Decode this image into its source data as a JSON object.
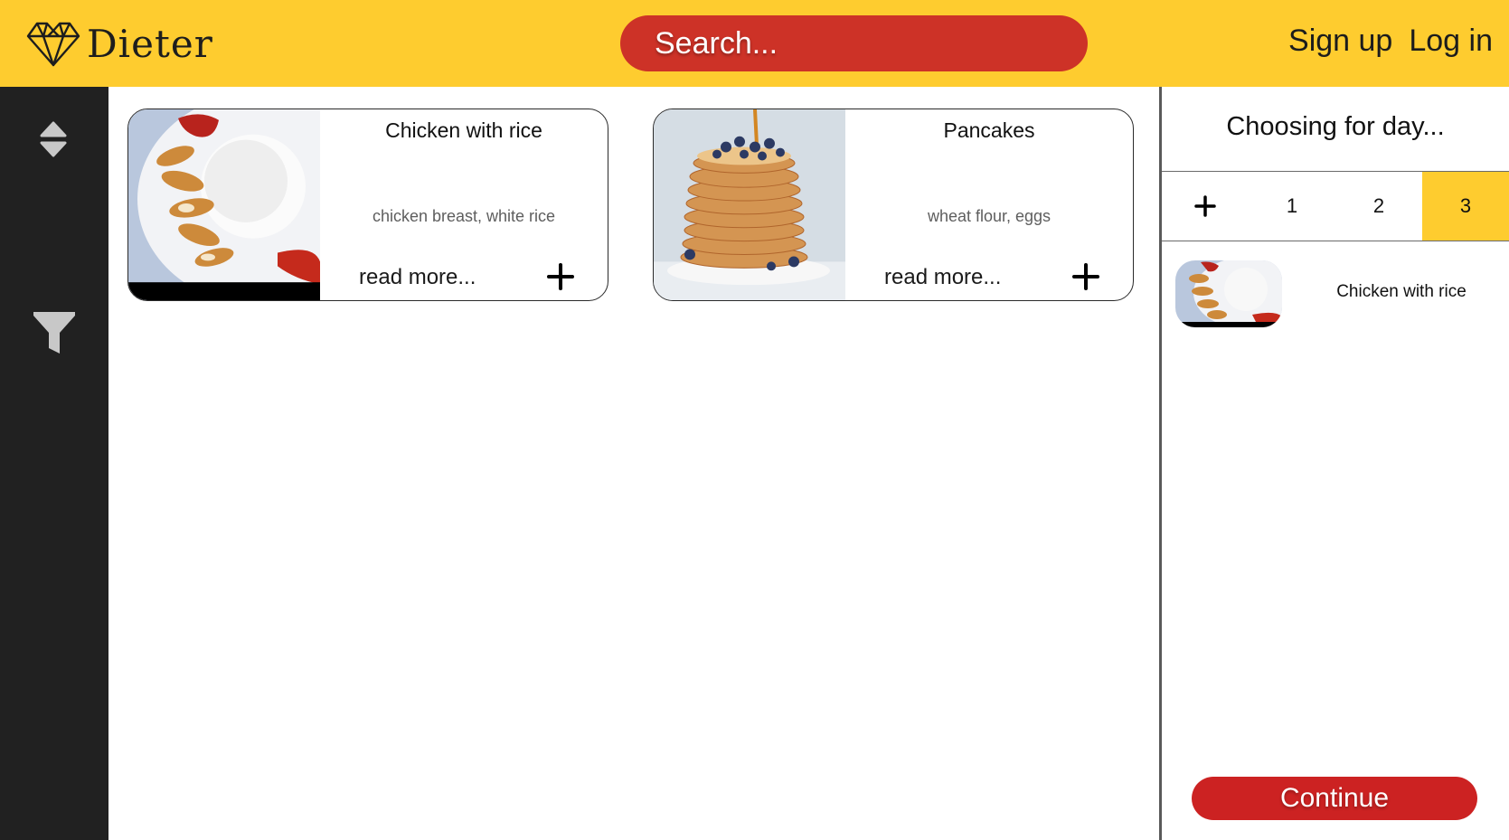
{
  "header": {
    "logo_text": "Dieter",
    "search_placeholder": "Search...",
    "signup_label": "Sign up",
    "login_label": "Log in"
  },
  "sidebar": {
    "icons": [
      "sort-icon",
      "filter-icon"
    ]
  },
  "recipes": [
    {
      "title": "Chicken with rice",
      "ingredients": "chicken breast, white rice",
      "read_more": "read more...",
      "image": "chicken-rice-photo"
    },
    {
      "title": "Pancakes",
      "ingredients": "wheat flour, eggs",
      "read_more": "read more...",
      "image": "pancakes-photo"
    }
  ],
  "panel": {
    "title": "Choosing for day...",
    "add_day_label": "+",
    "days": [
      "1",
      "2",
      "3"
    ],
    "active_day": "3",
    "chosen": [
      {
        "name": "Chicken with rice",
        "image": "chicken-rice-photo"
      }
    ],
    "continue_label": "Continue"
  },
  "colors": {
    "header_bg": "#fecc2f",
    "search_bg": "#cd3227",
    "sidebar_bg": "#212121",
    "continue_bg": "#cc2222",
    "active_tab_bg": "#fecc2f"
  }
}
